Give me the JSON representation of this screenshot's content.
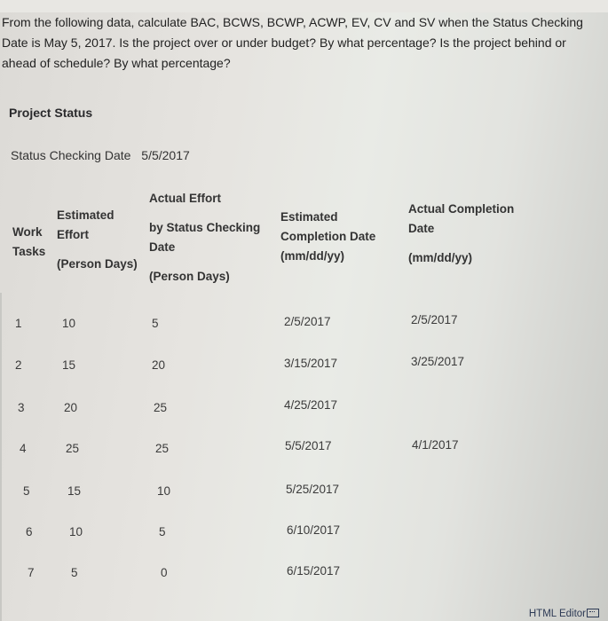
{
  "question": {
    "text": "From the following data, calculate BAC, BCWS, BCWP, ACWP, EV, CV and SV when the Status Checking Date is May 5, 2017.  Is the project over or under budget?  By what percentage?  Is the project behind or ahead of schedule?  By what percentage?"
  },
  "section": {
    "title": "Project Status",
    "status_label": "Status Checking Date",
    "status_value": "5/5/2017"
  },
  "table": {
    "headers": {
      "work_tasks": [
        "Work",
        "Tasks"
      ],
      "estimated_effort": [
        "Estimated",
        "Effort",
        "(Person Days)"
      ],
      "actual_effort": [
        "Actual Effort",
        "by Status Checking",
        "Date",
        "(Person Days)"
      ],
      "estimated_completion": [
        "Estimated",
        "Completion Date",
        "(mm/dd/yy)"
      ],
      "actual_completion": [
        "Actual Completion",
        "Date",
        "(mm/dd/yy)"
      ]
    },
    "rows": [
      {
        "task": "1",
        "estimated_effort": "10",
        "actual_effort": "5",
        "estimated_completion": "2/5/2017",
        "actual_completion": "2/5/2017"
      },
      {
        "task": "2",
        "estimated_effort": "15",
        "actual_effort": "20",
        "estimated_completion": "3/15/2017",
        "actual_completion": "3/25/2017"
      },
      {
        "task": "3",
        "estimated_effort": "20",
        "actual_effort": "25",
        "estimated_completion": "4/25/2017",
        "actual_completion": ""
      },
      {
        "task": "4",
        "estimated_effort": "25",
        "actual_effort": "25",
        "estimated_completion": "5/5/2017",
        "actual_completion": "4/1/2017"
      },
      {
        "task": "5",
        "estimated_effort": "15",
        "actual_effort": "10",
        "estimated_completion": "5/25/2017",
        "actual_completion": ""
      },
      {
        "task": "6",
        "estimated_effort": "10",
        "actual_effort": "5",
        "estimated_completion": "6/10/2017",
        "actual_completion": ""
      },
      {
        "task": "7",
        "estimated_effort": "5",
        "actual_effort": "0",
        "estimated_completion": "6/15/2017",
        "actual_completion": ""
      }
    ]
  },
  "footer": {
    "editor_label": "HTML Editor",
    "editor_icon": "keyboard-icon"
  }
}
